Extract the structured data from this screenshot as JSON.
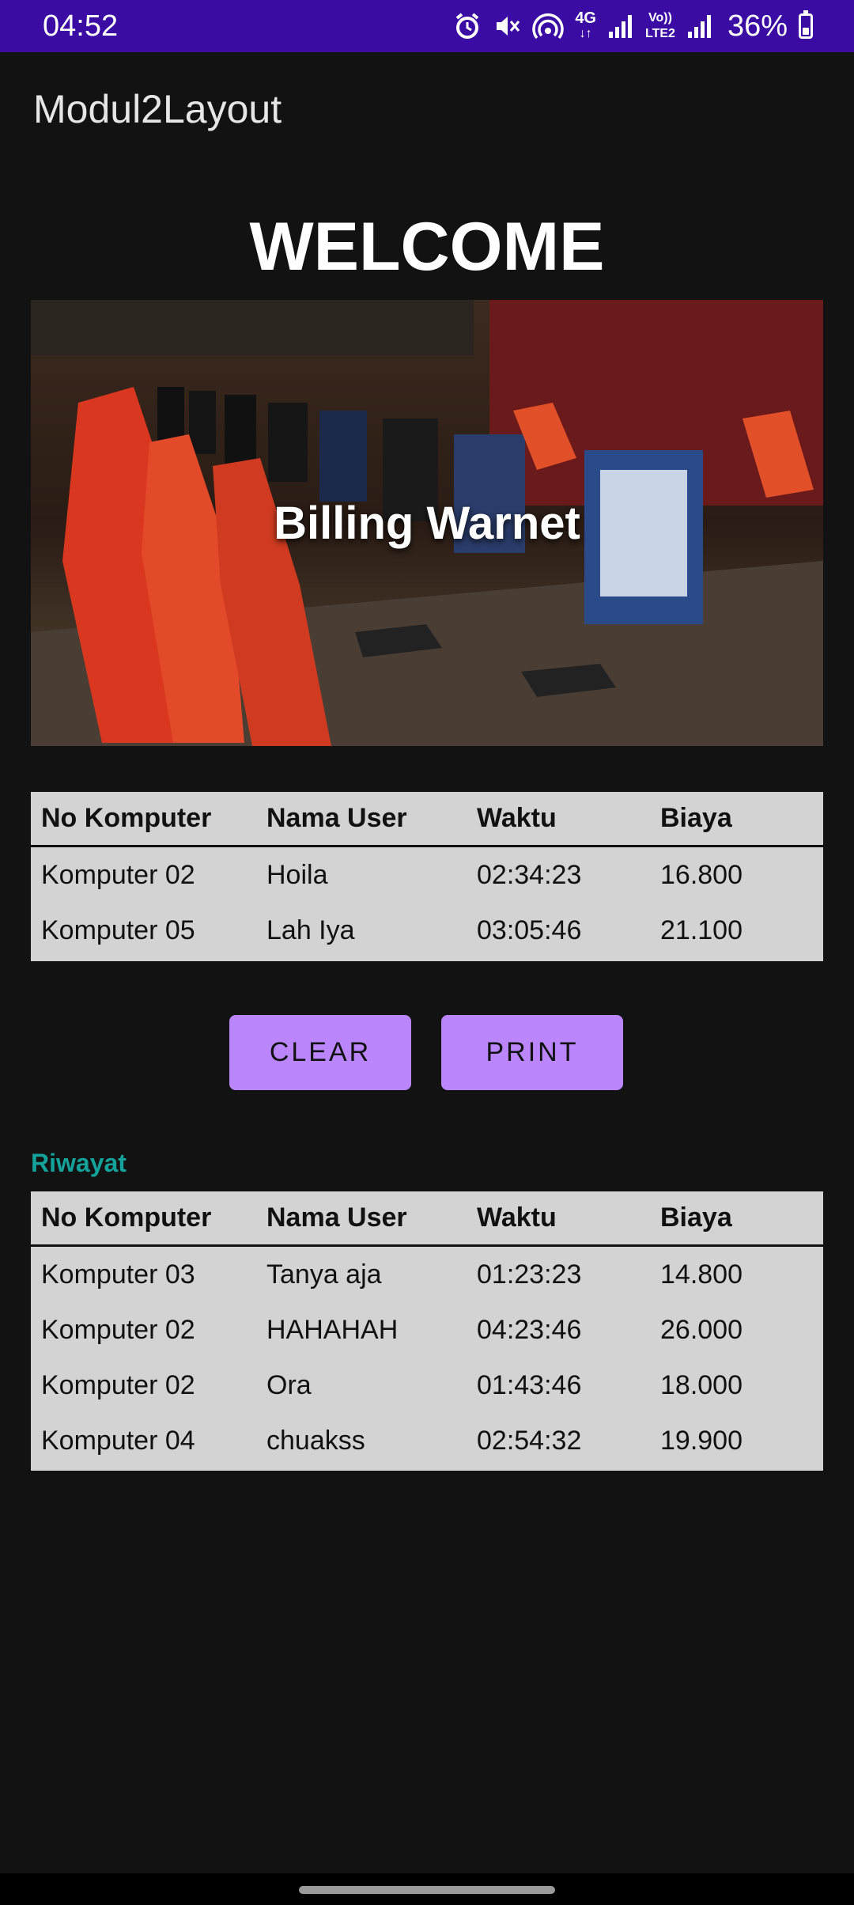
{
  "status_bar": {
    "time": "04:52",
    "network_type": "4G",
    "volte_label": "Vo))",
    "lte_label": "LTE2",
    "battery_percent": "36%",
    "battery_level": 0.36,
    "background_color": "#3a0ca3",
    "icons": [
      "alarm-icon",
      "mute-icon",
      "hotspot-icon",
      "signal-icon",
      "signal-icon-2",
      "battery-icon"
    ]
  },
  "app_bar": {
    "title": "Modul2Layout"
  },
  "welcome": {
    "heading": "WELCOME"
  },
  "hero": {
    "title": "Billing Warnet"
  },
  "current_table": {
    "headers": [
      "No Komputer",
      "Nama User",
      "Waktu",
      "Biaya"
    ],
    "rows": [
      [
        "Komputer 02",
        "Hoila",
        "02:34:23",
        "16.800"
      ],
      [
        "Komputer 05",
        "Lah Iya",
        "03:05:46",
        "21.100"
      ]
    ]
  },
  "actions": {
    "clear_label": "CLEAR",
    "print_label": "PRINT",
    "button_color": "#bb86fc"
  },
  "history": {
    "label": "Riwayat",
    "label_color": "#14a39a",
    "headers": [
      "No Komputer",
      "Nama User",
      "Waktu",
      "Biaya"
    ],
    "rows": [
      [
        "Komputer 03",
        "Tanya aja",
        "01:23:23",
        "14.800"
      ],
      [
        "Komputer 02",
        "HAHAHAH",
        "04:23:46",
        "26.000"
      ],
      [
        "Komputer 02",
        "Ora",
        "01:43:46",
        "18.000"
      ],
      [
        "Komputer 04",
        "chuakss",
        "02:54:32",
        "19.900"
      ]
    ]
  }
}
